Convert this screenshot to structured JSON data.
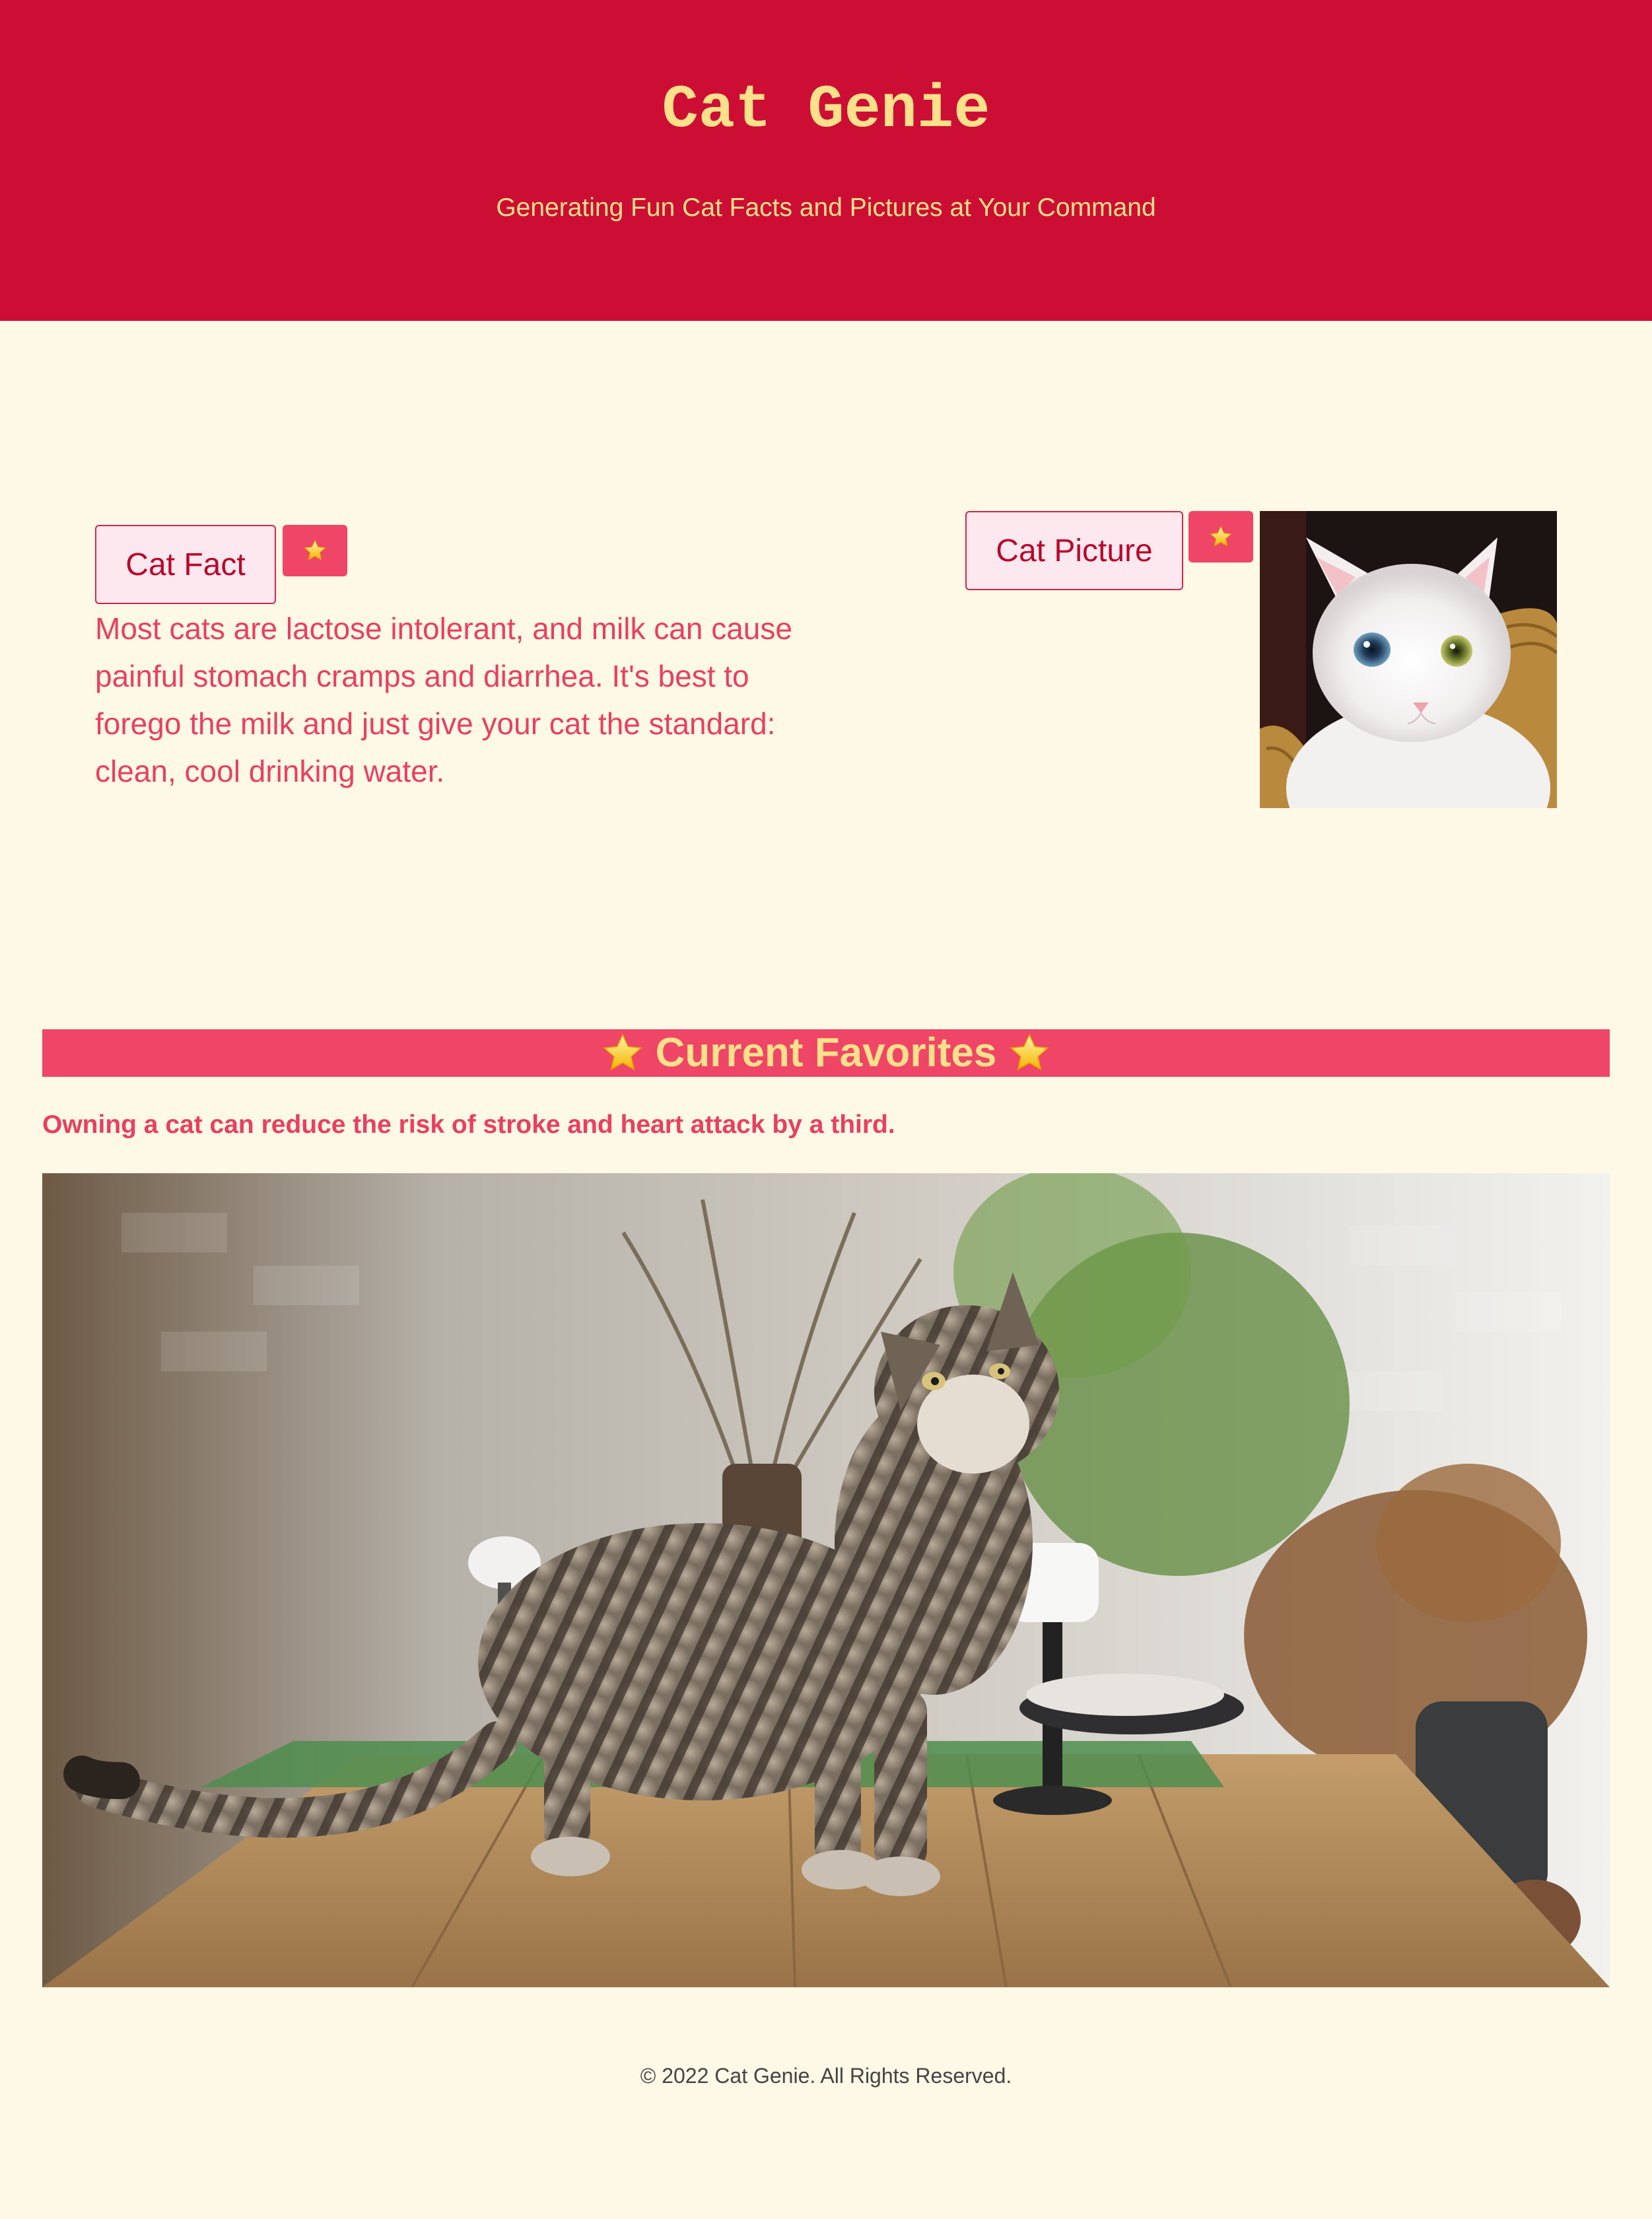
{
  "header": {
    "title": "Cat Genie",
    "subtitle": "Generating Fun Cat Facts and Pictures at Your Command"
  },
  "fact_panel": {
    "button_label": "Cat Fact",
    "favorite_icon": "star-icon",
    "fact_text": "Most cats are lactose intolerant, and milk can cause painful stomach cramps and diarrhea. It's best to forego the milk and just give your cat the standard: clean, cool drinking water."
  },
  "picture_panel": {
    "button_label": "Cat Picture",
    "favorite_icon": "star-icon"
  },
  "favorites": {
    "heading": "Current Favorites",
    "fact": "Owning a cat can reduce the risk of stroke and heart attack by a third."
  },
  "footer": {
    "copyright": "© 2022 Cat Genie. All Rights Reserved."
  },
  "colors": {
    "header_bg": "#cc0e34",
    "header_text": "#fde08a",
    "page_bg": "#fef8e6",
    "accent": "#ef4566",
    "body_text": "#e8405f",
    "button_bg": "#fee8ef",
    "button_text": "#b8082c"
  }
}
